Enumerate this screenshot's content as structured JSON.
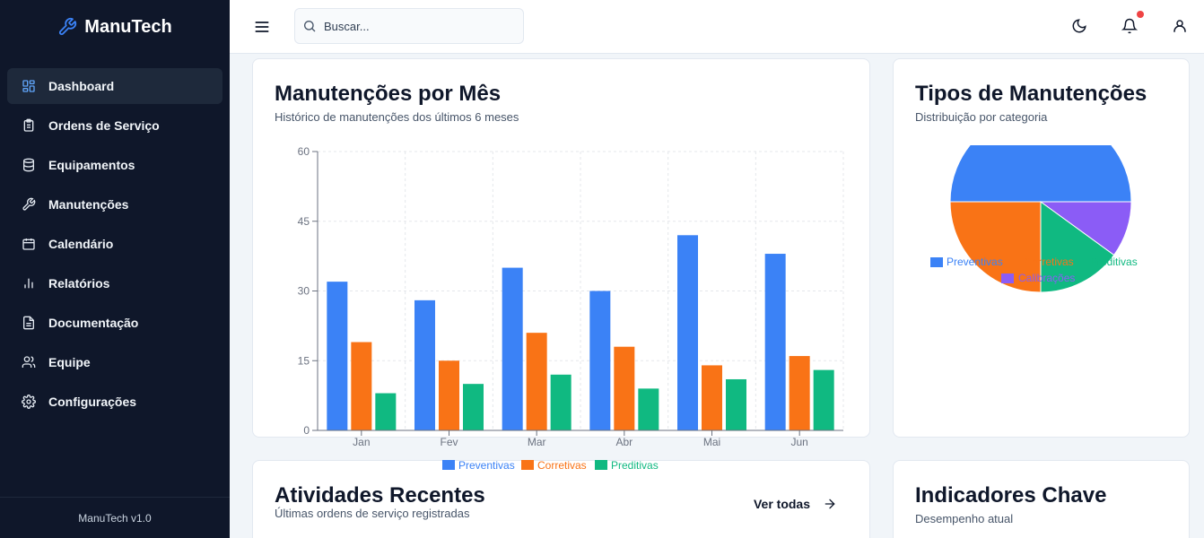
{
  "app": {
    "name": "ManuTech",
    "version": "ManuTech v1.0"
  },
  "sidebar": {
    "items": [
      {
        "label": "Dashboard",
        "icon": "dashboard-icon",
        "active": true
      },
      {
        "label": "Ordens de Serviço",
        "icon": "clipboard-icon"
      },
      {
        "label": "Equipamentos",
        "icon": "database-icon"
      },
      {
        "label": "Manutenções",
        "icon": "wrench-icon"
      },
      {
        "label": "Calendário",
        "icon": "calendar-icon"
      },
      {
        "label": "Relatórios",
        "icon": "bar-chart-icon"
      },
      {
        "label": "Documentação",
        "icon": "document-icon"
      },
      {
        "label": "Equipe",
        "icon": "users-icon"
      },
      {
        "label": "Configurações",
        "icon": "gear-icon"
      }
    ]
  },
  "topbar": {
    "search_placeholder": "Buscar..."
  },
  "cards": {
    "monthly": {
      "title": "Manutenções por Mês",
      "subtitle": "Histórico de manutenções dos últimos 6 meses"
    },
    "types": {
      "title": "Tipos de Manutenções",
      "subtitle": "Distribuição por categoria"
    },
    "recent": {
      "title": "Atividades Recentes",
      "subtitle": "Últimas ordens de serviço registradas",
      "action": "Ver todas"
    },
    "kpis": {
      "title": "Indicadores Chave",
      "subtitle": "Desempenho atual"
    }
  },
  "colors": {
    "preventivas": "#3b82f6",
    "corretivas": "#f97316",
    "preditivas": "#10b981",
    "calibracoes": "#8b5cf6",
    "notification": "#ef4444"
  },
  "chart_data": [
    {
      "type": "bar",
      "categories": [
        "Jan",
        "Fev",
        "Mar",
        "Abr",
        "Mai",
        "Jun"
      ],
      "series": [
        {
          "name": "Preventivas",
          "values": [
            32,
            28,
            35,
            30,
            42,
            38
          ]
        },
        {
          "name": "Corretivas",
          "values": [
            19,
            15,
            21,
            18,
            14,
            16
          ]
        },
        {
          "name": "Preditivas",
          "values": [
            8,
            10,
            12,
            9,
            11,
            13
          ]
        }
      ],
      "yticks": [
        "0",
        "15",
        "30",
        "45",
        "60"
      ],
      "ylim": [
        0,
        60
      ],
      "grid": true,
      "legend": "bottom"
    },
    {
      "type": "pie",
      "labels": [
        "Preventivas",
        "Corretivas",
        "Preditivas",
        "Calibrações"
      ],
      "values": [
        50,
        25,
        15,
        10
      ],
      "legend": "overlapping-bottom"
    }
  ]
}
